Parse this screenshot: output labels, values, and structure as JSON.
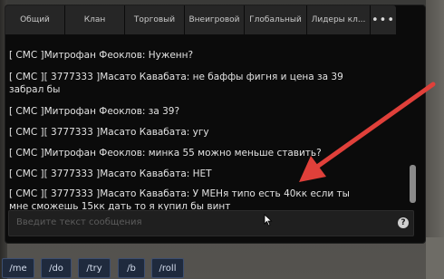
{
  "tabs": [
    {
      "label": "Общий"
    },
    {
      "label": "Клан"
    },
    {
      "label": "Торговый"
    },
    {
      "label": "Внеигровой"
    },
    {
      "label": "Глобальный"
    },
    {
      "label": "Лидеры кл..."
    },
    {
      "label": "•••"
    }
  ],
  "messages": [
    {
      "lines": [
        "[ СМС ]Митрофан Феоклов: Нуженн?"
      ]
    },
    {
      "lines": [
        "[ СМС ][ 3777333 ]Масато Кавабата: не баффы фигня и цена за 39",
        "забрал бы"
      ]
    },
    {
      "lines": [
        "[ СМС ]Митрофан Феоклов: за 39?"
      ]
    },
    {
      "lines": [
        "[ СМС ][ 3777333 ]Масато Кавабата: угу"
      ]
    },
    {
      "lines": [
        "[ СМС ]Митрофан Феоклов: минка 55 можно меньше ставить?"
      ]
    },
    {
      "lines": [
        "[ СМС ][ 3777333 ]Масато Кавабата: НЕТ"
      ]
    },
    {
      "lines": [
        "[ СМС ][ 3777333 ]Масато Кавабата: У МЕНя типо есть 40кк если ты",
        "мне сможешь 15кк дать то я купил бы винт"
      ]
    }
  ],
  "input": {
    "placeholder": "Введите текст сообщения"
  },
  "help_icon": {
    "icon": "question-icon",
    "glyph": "?"
  },
  "commands": [
    "/me",
    "/do",
    "/try",
    "/b",
    "/roll"
  ],
  "colors": {
    "chat_bg": "#0b0b0b",
    "tab_bg": "#262626",
    "text": "#e3e3e3",
    "arrow": "#e0403a",
    "cmd_bg": "#1f2a3d"
  }
}
